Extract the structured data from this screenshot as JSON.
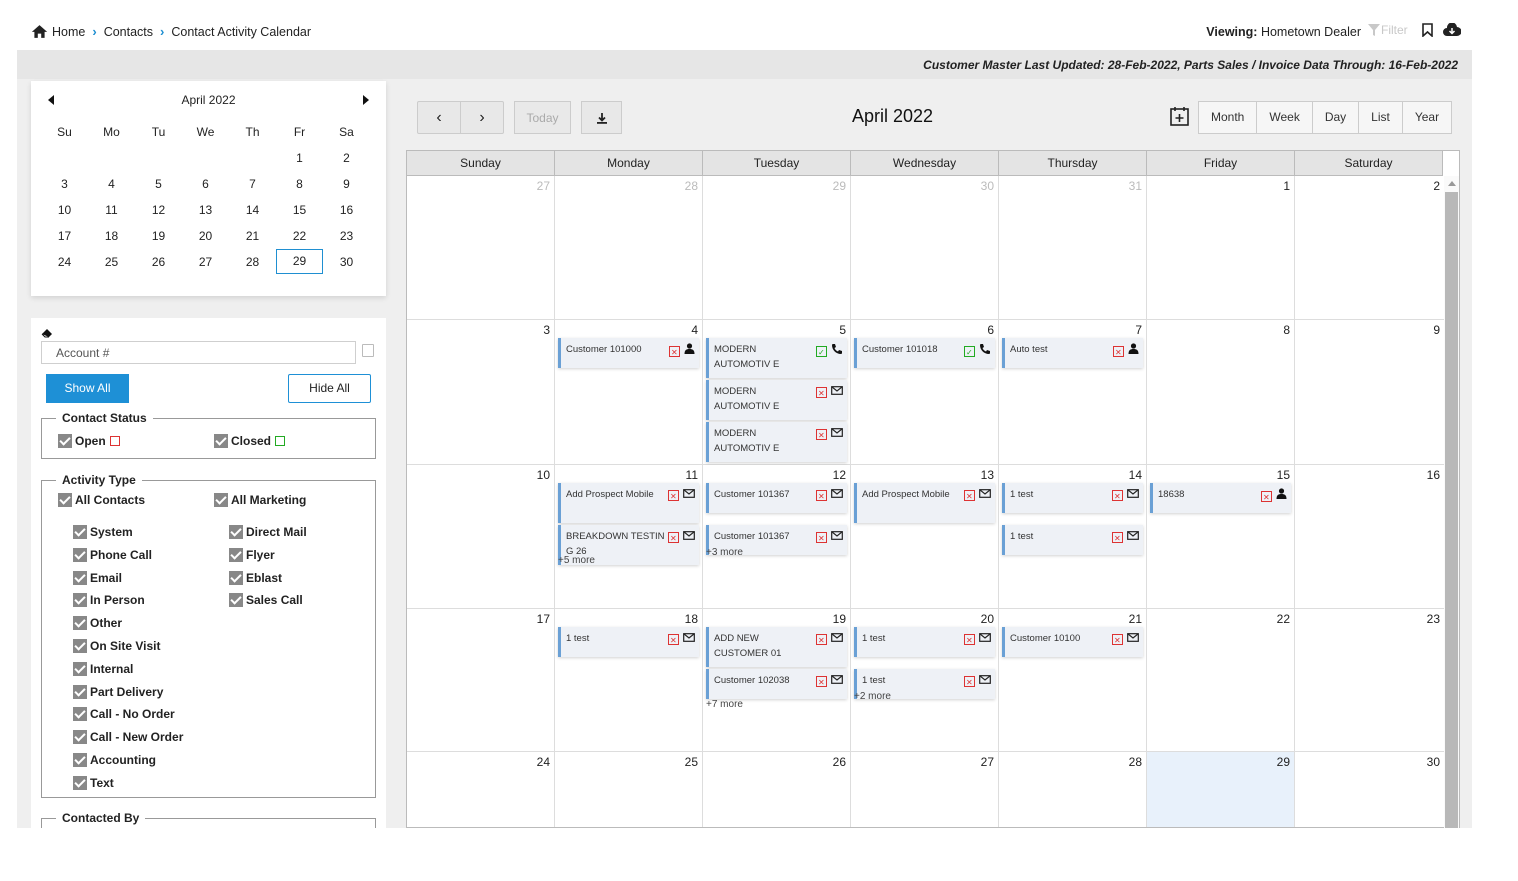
{
  "breadcrumb": {
    "home": "Home",
    "contacts": "Contacts",
    "current": "Contact Activity Calendar"
  },
  "header": {
    "viewing_label": "Viewing:",
    "viewing_value": "Hometown Dealer",
    "filter": "Filter"
  },
  "status_strip": "Customer Master Last Updated: 28-Feb-2022, Parts Sales / Invoice Data Through: 16-Feb-2022",
  "mini_calendar": {
    "title": "April 2022",
    "weekdays": [
      "Su",
      "Mo",
      "Tu",
      "We",
      "Th",
      "Fr",
      "Sa"
    ],
    "weeks": [
      [
        "",
        "",
        "",
        "",
        "",
        "1",
        "2"
      ],
      [
        "3",
        "4",
        "5",
        "6",
        "7",
        "8",
        "9"
      ],
      [
        "10",
        "11",
        "12",
        "13",
        "14",
        "15",
        "16"
      ],
      [
        "17",
        "18",
        "19",
        "20",
        "21",
        "22",
        "23"
      ],
      [
        "24",
        "25",
        "26",
        "27",
        "28",
        "29",
        "30"
      ]
    ],
    "selected": "29"
  },
  "filters": {
    "account_placeholder": "Account #",
    "show_all": "Show All",
    "hide_all": "Hide All",
    "contact_status": {
      "legend": "Contact Status",
      "open": "Open",
      "closed": "Closed"
    },
    "activity_type": {
      "legend": "Activity Type",
      "all_contacts": "All Contacts",
      "all_marketing": "All Marketing",
      "left": [
        "System",
        "Phone Call",
        "Email",
        "In Person",
        "Other",
        "On Site Visit",
        "Internal",
        "Part Delivery",
        "Call - No Order",
        "Call - New Order",
        "Accounting",
        "Text"
      ],
      "right": [
        "Direct Mail",
        "Flyer",
        "Eblast",
        "Sales Call"
      ]
    },
    "contacted_by": "Contacted By"
  },
  "toolbar": {
    "today": "Today",
    "title": "April 2022",
    "views": [
      "Month",
      "Week",
      "Day",
      "List",
      "Year"
    ]
  },
  "calendar": {
    "weekdays": [
      "Sunday",
      "Monday",
      "Tuesday",
      "Wednesday",
      "Thursday",
      "Friday",
      "Saturday"
    ],
    "weeks": [
      [
        {
          "d": "27",
          "dim": true
        },
        {
          "d": "28",
          "dim": true
        },
        {
          "d": "29",
          "dim": true
        },
        {
          "d": "30",
          "dim": true
        },
        {
          "d": "31",
          "dim": true
        },
        {
          "d": "1"
        },
        {
          "d": "2"
        }
      ],
      [
        {
          "d": "3"
        },
        {
          "d": "4",
          "events": [
            {
              "t": "Customer 101000",
              "s": "x",
              "k": "person"
            }
          ]
        },
        {
          "d": "5",
          "events": [
            {
              "t": "MODERN AUTOMOTIV E",
              "s": "c",
              "k": "phone"
            },
            {
              "t": "MODERN AUTOMOTIV E",
              "s": "x",
              "k": "mail"
            },
            {
              "t": "MODERN AUTOMOTIV E",
              "s": "x",
              "k": "mail"
            }
          ]
        },
        {
          "d": "6",
          "events": [
            {
              "t": "Customer 101018",
              "s": "c",
              "k": "phone"
            }
          ]
        },
        {
          "d": "7",
          "events": [
            {
              "t": "Auto test",
              "s": "x",
              "k": "person"
            }
          ]
        },
        {
          "d": "8"
        },
        {
          "d": "9"
        }
      ],
      [
        {
          "d": "10"
        },
        {
          "d": "11",
          "events": [
            {
              "t": "Add Prospect Mobile",
              "s": "x",
              "k": "mail"
            },
            {
              "t": "BREAKDOWN TESTIN G 26",
              "s": "x",
              "k": "mail"
            }
          ],
          "more": "+5 more"
        },
        {
          "d": "12",
          "events": [
            {
              "t": "Customer 101367",
              "s": "x",
              "k": "mail"
            },
            {
              "t": "Customer 101367",
              "s": "x",
              "k": "mail"
            }
          ],
          "more": "+3 more"
        },
        {
          "d": "13",
          "events": [
            {
              "t": "Add Prospect Mobile",
              "s": "x",
              "k": "mail"
            }
          ]
        },
        {
          "d": "14",
          "events": [
            {
              "t": "1 test",
              "s": "x",
              "k": "mail"
            },
            {
              "t": "1 test",
              "s": "x",
              "k": "mail"
            }
          ]
        },
        {
          "d": "15",
          "events": [
            {
              "t": "18638",
              "s": "x",
              "k": "person"
            }
          ]
        },
        {
          "d": "16"
        }
      ],
      [
        {
          "d": "17"
        },
        {
          "d": "18",
          "events": [
            {
              "t": "1 test",
              "s": "x",
              "k": "mail"
            }
          ]
        },
        {
          "d": "19",
          "events": [
            {
              "t": "ADD NEW CUSTOMER 01",
              "s": "x",
              "k": "mail"
            },
            {
              "t": "Customer 102038",
              "s": "x",
              "k": "mail"
            }
          ],
          "more": "+7 more"
        },
        {
          "d": "20",
          "events": [
            {
              "t": "1 test",
              "s": "x",
              "k": "mail"
            },
            {
              "t": "1 test",
              "s": "x",
              "k": "mail"
            }
          ],
          "more": "+2 more"
        },
        {
          "d": "21",
          "events": [
            {
              "t": "Customer 10100",
              "s": "x",
              "k": "mail"
            }
          ]
        },
        {
          "d": "22"
        },
        {
          "d": "23"
        }
      ],
      [
        {
          "d": "24"
        },
        {
          "d": "25"
        },
        {
          "d": "26"
        },
        {
          "d": "27"
        },
        {
          "d": "28"
        },
        {
          "d": "29",
          "today": true
        },
        {
          "d": "30"
        }
      ]
    ]
  }
}
